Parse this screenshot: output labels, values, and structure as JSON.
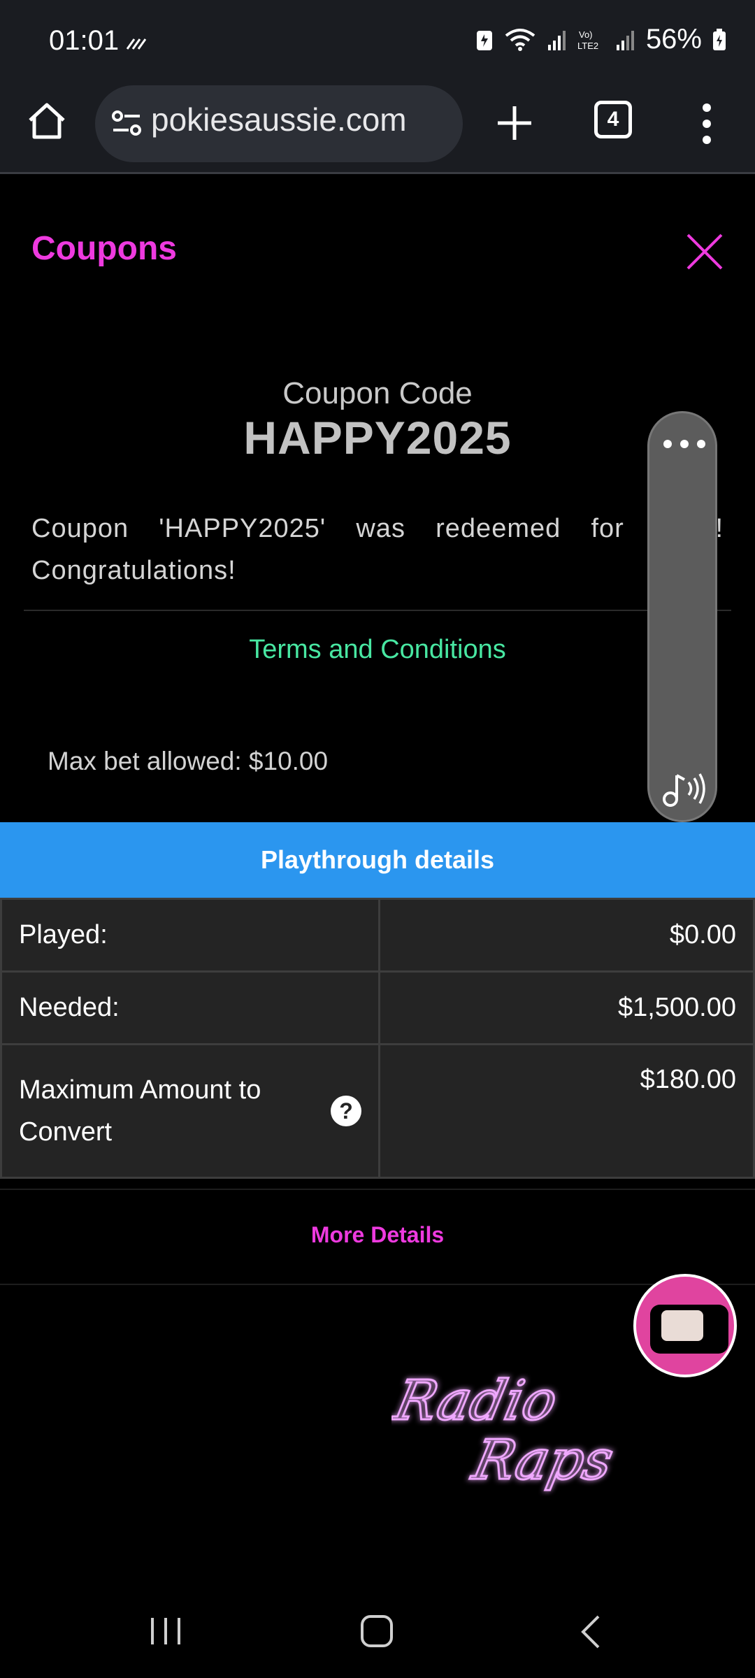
{
  "status_bar": {
    "time": "01:01",
    "battery": "56%"
  },
  "browser": {
    "url": "pokiesaussie.com",
    "tab_count": "4"
  },
  "coupons": {
    "title": "Coupons",
    "code_label": "Coupon Code",
    "code": "HAPPY2025",
    "message": "Coupon 'HAPPY2025' was redeemed for $2 ! Congratulations!",
    "terms_link": "Terms and Conditions",
    "max_bet": "Max bet allowed: $10.00"
  },
  "playthrough": {
    "header": "Playthrough details",
    "rows": [
      {
        "label": "Played:",
        "value": "$0.00"
      },
      {
        "label": "Needed:",
        "value": "$1,500.00"
      },
      {
        "label": "Maximum Amount to Convert",
        "value": "$180.00"
      }
    ],
    "more_details": "More Details"
  },
  "logo": {
    "line1": "Radio",
    "line2": "Raps"
  },
  "colors": {
    "accent_pink": "#ee3adf",
    "terms_green": "#48e7a2",
    "header_blue": "#2b96ef"
  }
}
